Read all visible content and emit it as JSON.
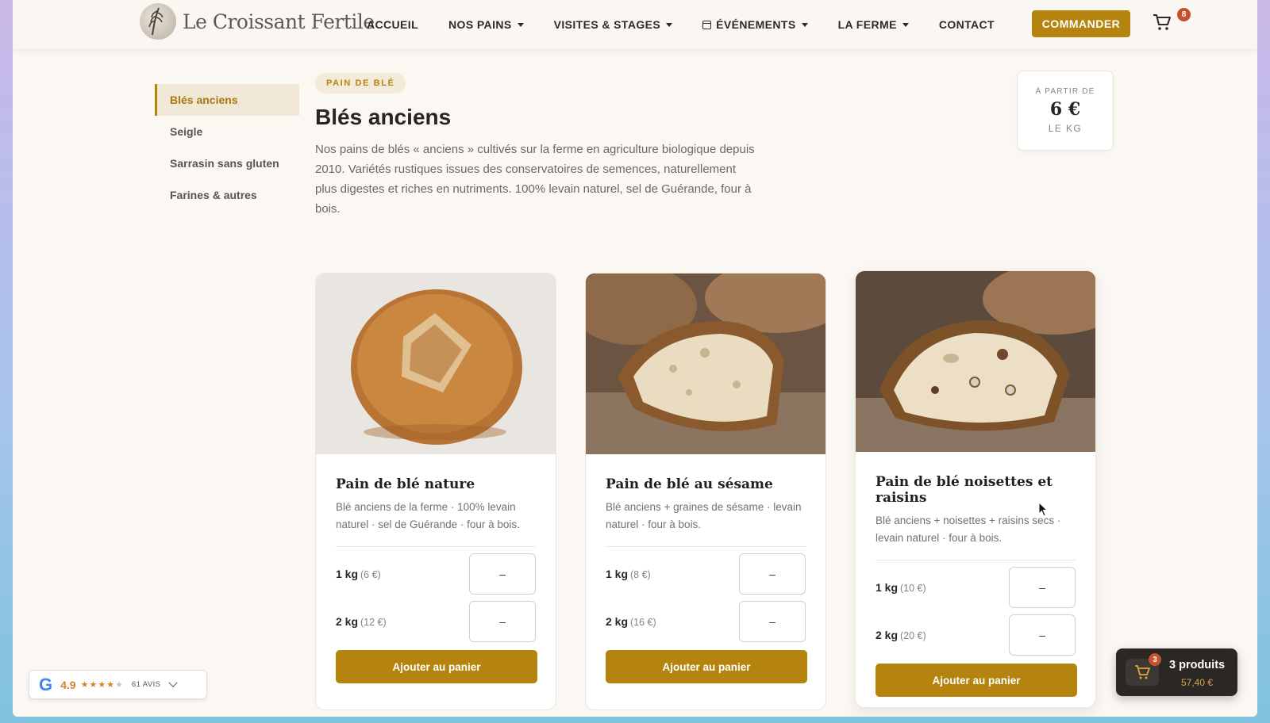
{
  "brand": {
    "name": "Le Croissant Fertile"
  },
  "nav": {
    "items": [
      {
        "label": "ACCUEIL",
        "dropdown": false
      },
      {
        "label": "NOS PAINS",
        "dropdown": true
      },
      {
        "label": "VISITES & STAGES",
        "dropdown": true
      },
      {
        "label": "ÉVÉNEMENTS",
        "dropdown": true
      },
      {
        "label": "LA FERME",
        "dropdown": true
      },
      {
        "label": "CONTACT",
        "dropdown": false
      }
    ],
    "order_button": "COMMANDER",
    "cart_count": "8"
  },
  "sidebar": {
    "items": [
      {
        "label": "Blés anciens",
        "active": true
      },
      {
        "label": "Seigle",
        "active": false
      },
      {
        "label": "Sarrasin sans gluten",
        "active": false
      },
      {
        "label": "Farines & autres",
        "active": false
      }
    ]
  },
  "section": {
    "tag": "PAIN DE BLÉ",
    "title": "Blés anciens",
    "intro": "Nos pains de blés « anciens » cultivés sur la ferme en agriculture biologique depuis 2010. Variétés rustiques issues des conservatoires de semences, naturellement plus digestes et riches en nutriments. 100% levain naturel, sel de Guérande, four à bois."
  },
  "price_box": {
    "from": "À PARTIR DE",
    "amount": "6 €",
    "unit": "LE KG"
  },
  "products": [
    {
      "title": "Pain de blé nature",
      "desc": "Blé anciens de la ferme · 100% levain naturel · sel de Guérande · four à bois.",
      "options": [
        {
          "weight": "1 kg",
          "price": "(6 €)",
          "qty": "–"
        },
        {
          "weight": "2 kg",
          "price": "(12 €)",
          "qty": "–"
        }
      ],
      "button": "Ajouter au panier"
    },
    {
      "title": "Pain de blé au sésame",
      "desc": "Blé anciens + graines de sésame · levain naturel · four à bois.",
      "options": [
        {
          "weight": "1 kg",
          "price": "(8 €)",
          "qty": "–"
        },
        {
          "weight": "2 kg",
          "price": "(16 €)",
          "qty": "–"
        }
      ],
      "button": "Ajouter au panier"
    },
    {
      "title": "Pain de blé noisettes et raisins",
      "desc": "Blé anciens + noisettes + raisins secs · levain naturel · four à bois.",
      "options": [
        {
          "weight": "1 kg",
          "price": "(10 €)",
          "qty": "–"
        },
        {
          "weight": "2 kg",
          "price": "(20 €)",
          "qty": "–"
        }
      ],
      "button": "Ajouter au panier"
    }
  ],
  "google_widget": {
    "letter": "G",
    "rating": "4.9",
    "stars_filled": 4,
    "reviews": "61 AVIS"
  },
  "floating_cart": {
    "badge": "3",
    "count": "3 produits",
    "total": "57,40 €"
  },
  "colors": {
    "accent": "#b5840f",
    "badge": "#c7512e",
    "dark": "#2b2724",
    "background": "#fbf8f3"
  }
}
